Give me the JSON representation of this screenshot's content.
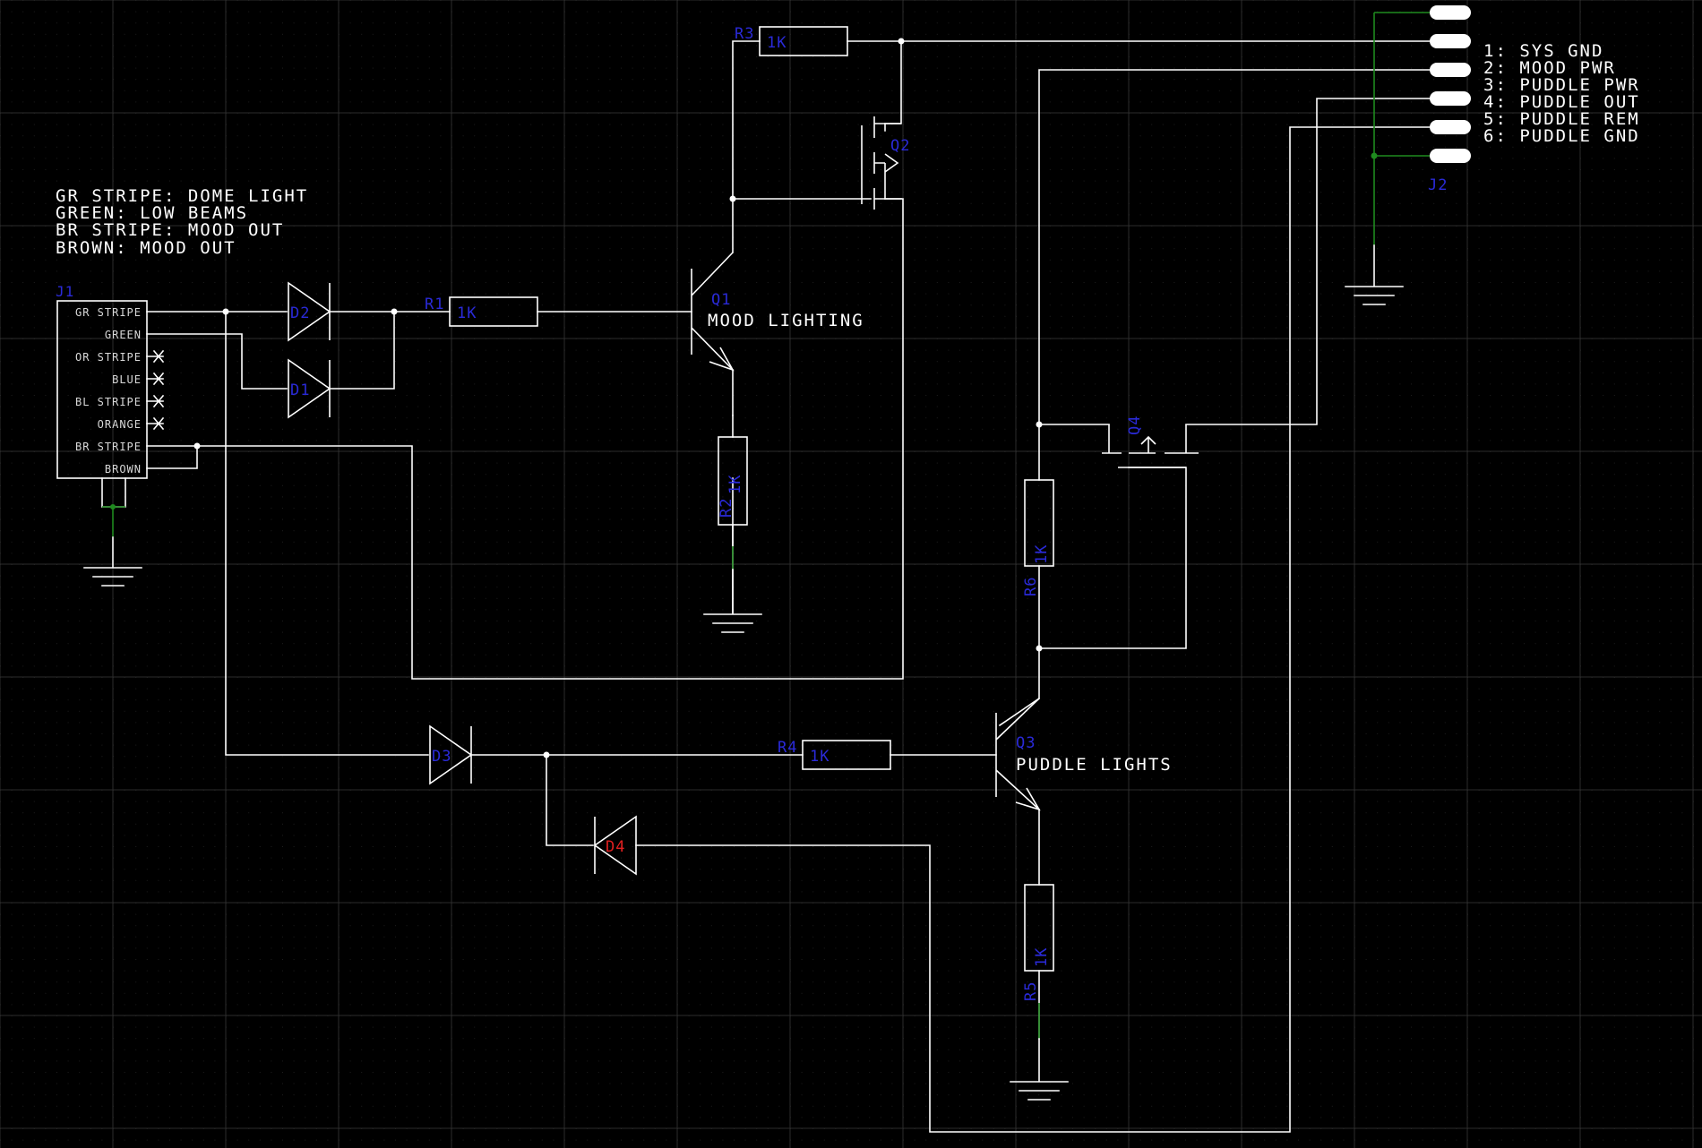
{
  "colors": {
    "background": "#000000",
    "wire": "#ffffff",
    "designator": "#2a2ad8",
    "highlight": "#e02020",
    "ground_net": "#1f8a1f",
    "grid": "#2c2c2c"
  },
  "notes": [
    "GR STRIPE: DOME LIGHT",
    "GREEN: LOW BEAMS",
    "BR STRIPE: MOOD OUT",
    "BROWN: MOOD OUT"
  ],
  "j1": {
    "designator": "J1",
    "pins": [
      "GR STRIPE",
      "GREEN",
      "OR STRIPE",
      "BLUE",
      "BL STRIPE",
      "ORANGE",
      "BR STRIPE",
      "BROWN"
    ]
  },
  "j2": {
    "designator": "J2",
    "pins": [
      "1: SYS GND",
      "2: MOOD PWR",
      "3: PUDDLE PWR",
      "4: PUDDLE OUT",
      "5: PUDDLE REM",
      "6: PUDDLE GND"
    ]
  },
  "components": {
    "D1": "D1",
    "D2": "D2",
    "D3": "D3",
    "D4": "D4",
    "R1": "R1",
    "R2": "R2",
    "R3": "R3",
    "R4": "R4",
    "R5": "R5",
    "R6": "R6",
    "Q1": "Q1",
    "Q2": "Q2",
    "Q3": "Q3",
    "Q4": "Q4"
  },
  "values": {
    "R1": "1K",
    "R2": "1K",
    "R3": "1K",
    "R4": "1K",
    "R5": "1K",
    "R6": "1K"
  },
  "blocks": {
    "mood": "MOOD LIGHTING",
    "puddle": "PUDDLE LIGHTS"
  }
}
